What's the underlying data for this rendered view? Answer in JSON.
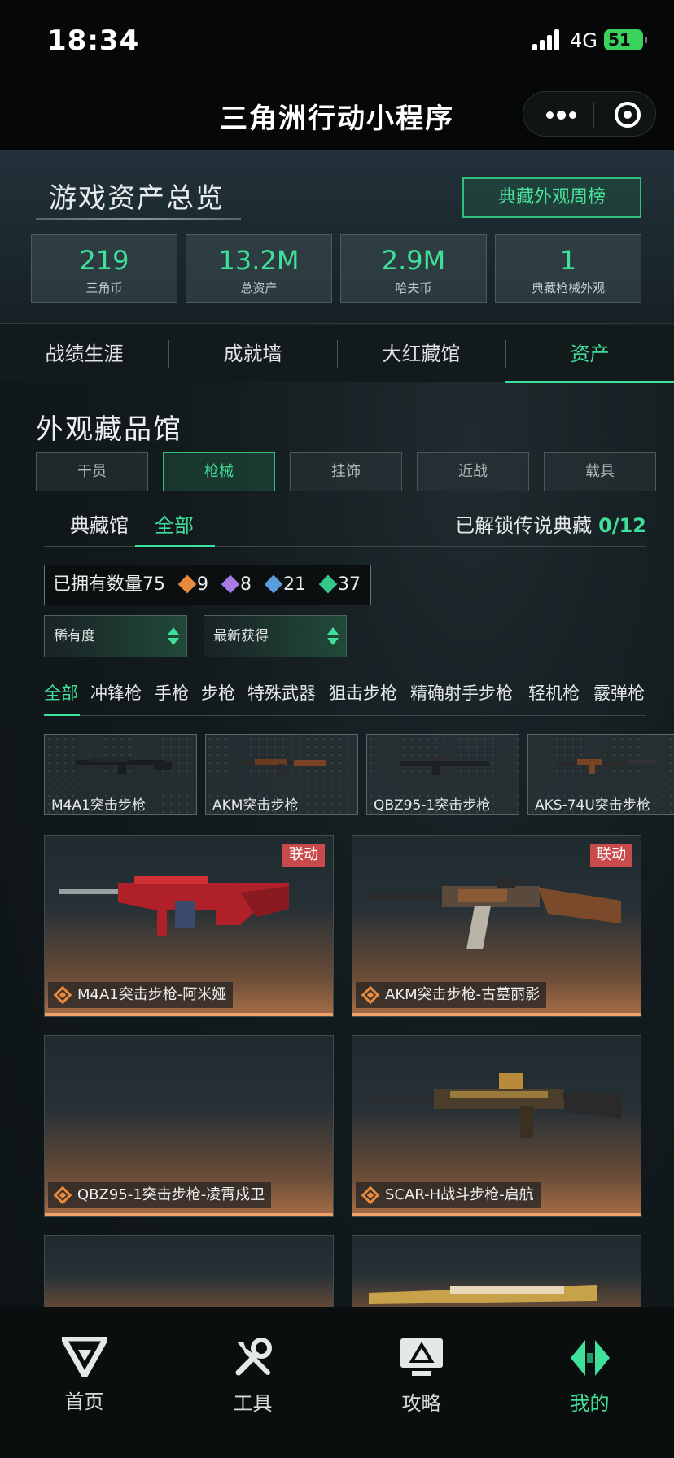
{
  "status_bar": {
    "time": "18:34",
    "network": "4G",
    "battery": "51"
  },
  "title_bar": {
    "title": "三角洲行动小程序"
  },
  "overview": {
    "title": "游戏资产总览",
    "weekly_button": "典藏外观周榜",
    "stats": [
      {
        "value": "219",
        "label": "三角币"
      },
      {
        "value": "13.2M",
        "label": "总资产"
      },
      {
        "value": "2.9M",
        "label": "哈夫币"
      },
      {
        "value": "1",
        "label": "典藏枪械外观"
      }
    ]
  },
  "main_tabs": [
    {
      "label": "战绩生涯"
    },
    {
      "label": "成就墙"
    },
    {
      "label": "大红藏馆"
    },
    {
      "label": "资产"
    }
  ],
  "collection": {
    "title": "外观藏品馆",
    "categories": [
      {
        "label": "干员"
      },
      {
        "label": "枪械"
      },
      {
        "label": "挂饰"
      },
      {
        "label": "近战"
      },
      {
        "label": "载具"
      }
    ],
    "subtabs": [
      {
        "label": "典藏馆"
      },
      {
        "label": "全部"
      }
    ],
    "unlock_label": "已解锁传说典藏",
    "unlock_value": "0/12",
    "owned_label": "已拥有数量75",
    "owned_counts": [
      "9",
      "8",
      "21",
      "37"
    ],
    "rarity_colors": [
      "#e98a3c",
      "#a87be6",
      "#5a9ee0",
      "#35c78a"
    ],
    "sort_rarity": "稀有度",
    "sort_recent": "最新获得",
    "filters": [
      {
        "label": "全部"
      },
      {
        "label": "冲锋枪"
      },
      {
        "label": "手枪"
      },
      {
        "label": "步枪"
      },
      {
        "label": "特殊武器"
      },
      {
        "label": "狙击步枪"
      },
      {
        "label": "精确射手步枪"
      },
      {
        "label": "轻机枪"
      },
      {
        "label": "霰弹枪"
      }
    ],
    "thumbnails": [
      {
        "name": "M4A1突击步枪"
      },
      {
        "name": "AKM突击步枪"
      },
      {
        "name": "QBZ95-1突击步枪"
      },
      {
        "name": "AKS-74U突击步枪"
      }
    ],
    "skins": [
      {
        "name": "M4A1突击步枪-阿米娅",
        "badge": "联动"
      },
      {
        "name": "AKM突击步枪-古墓丽影",
        "badge": "联动"
      },
      {
        "name": "QBZ95-1突击步枪-凌霄戍卫",
        "badge": ""
      },
      {
        "name": "SCAR-H战斗步枪-启航",
        "badge": ""
      }
    ]
  },
  "bottom_nav": [
    {
      "label": "首页",
      "icon": "delta-logo-icon"
    },
    {
      "label": "工具",
      "icon": "tools-icon"
    },
    {
      "label": "攻略",
      "icon": "monitor-icon"
    },
    {
      "label": "我的",
      "icon": "profile-logo-icon"
    }
  ],
  "colors": {
    "accent": "#3fe09a",
    "badge": "#c84a4b",
    "rarity_gold": "#e98a3c"
  }
}
